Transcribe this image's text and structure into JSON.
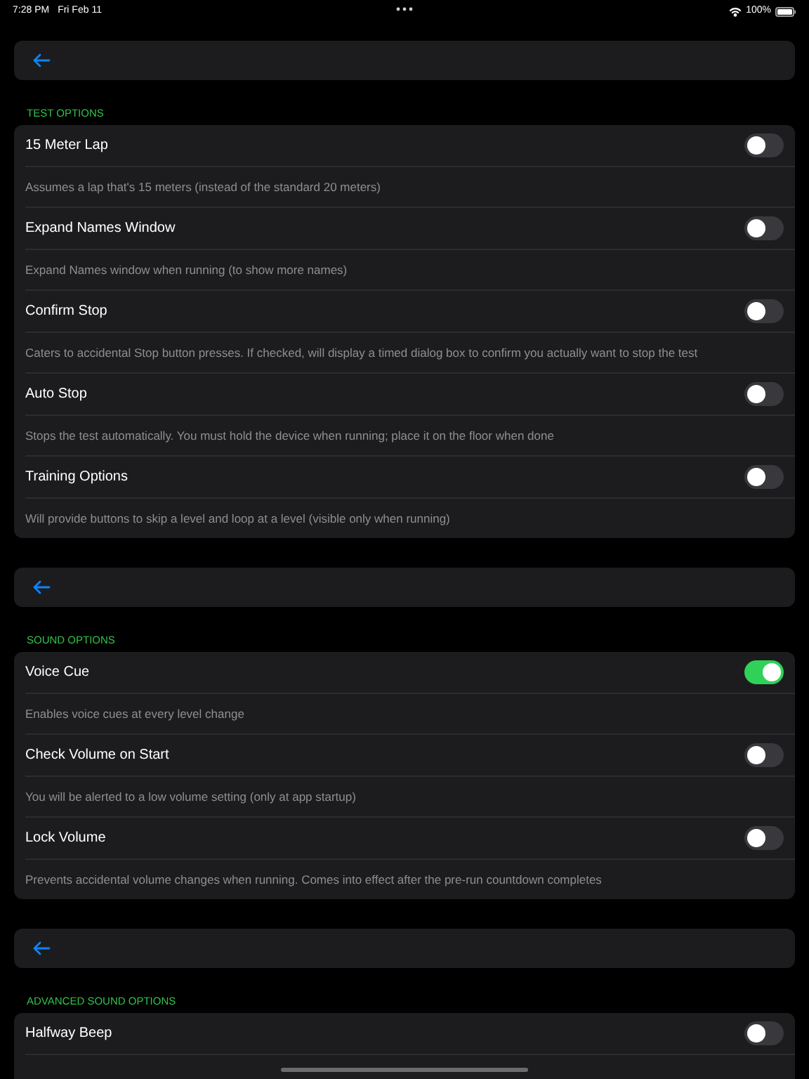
{
  "status_bar": {
    "time": "7:28 PM",
    "date": "Fri Feb 11",
    "battery": "100%"
  },
  "sections": [
    {
      "title": "TEST OPTIONS",
      "options": [
        {
          "label": "15 Meter Lap",
          "on": false,
          "description": "Assumes a lap that's 15 meters (instead of the standard 20 meters)"
        },
        {
          "label": "Expand Names Window",
          "on": false,
          "description": "Expand Names window when running (to show more names)"
        },
        {
          "label": "Confirm Stop",
          "on": false,
          "description": "Caters to accidental Stop button presses. If checked, will display a timed dialog box to confirm you actually want to stop the test"
        },
        {
          "label": "Auto Stop",
          "on": false,
          "description": "Stops the test automatically. You must hold the device when running; place it on the floor when done"
        },
        {
          "label": "Training Options",
          "on": false,
          "description": "Will provide buttons to skip a level and loop at a level (visible only when running)"
        }
      ]
    },
    {
      "title": "SOUND OPTIONS",
      "options": [
        {
          "label": "Voice Cue",
          "on": true,
          "description": "Enables voice cues at every level change"
        },
        {
          "label": "Check Volume on Start",
          "on": false,
          "description": "You will be alerted to a low volume setting (only at app startup)"
        },
        {
          "label": "Lock Volume",
          "on": false,
          "description": "Prevents accidental volume changes when running. Comes into effect after the pre-run countdown completes"
        }
      ]
    },
    {
      "title": "ADVANCED SOUND OPTIONS",
      "options": [
        {
          "label": "Halfway Beep",
          "on": false
        }
      ]
    }
  ]
}
